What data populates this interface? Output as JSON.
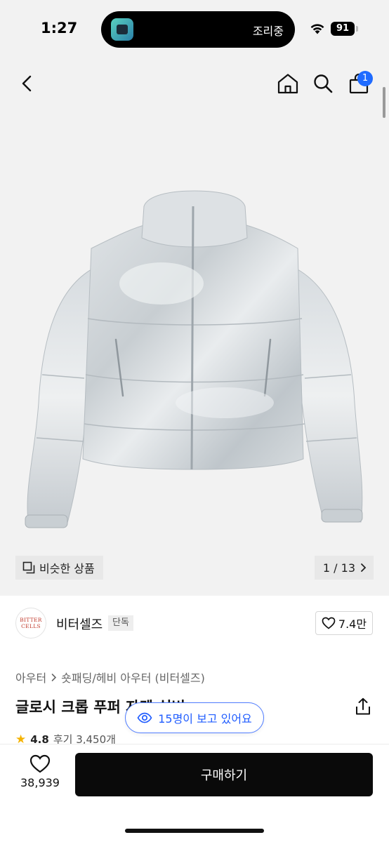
{
  "status_bar": {
    "time": "1:27",
    "live_activity": "조리중",
    "battery": "91"
  },
  "nav": {
    "cart_count": "1",
    "icons": [
      "back-arrow-icon",
      "home-icon",
      "search-icon",
      "cart-icon"
    ]
  },
  "gallery": {
    "similar_label": "비슷한 상품",
    "counter": "1 / 13"
  },
  "brand": {
    "logo_text_line1": "BITTER",
    "logo_text_line2": "CELLS",
    "name": "비터셀즈",
    "tag": "단독",
    "likes": "7.4만"
  },
  "breadcrumb": {
    "category": "아우터",
    "subcategory": "숏패딩/헤비 아우터 (비터셀즈)"
  },
  "product": {
    "title": "글로시 크롭 푸퍼 자켓 실버",
    "rating": "4.8",
    "reviews": "후기 3,450개"
  },
  "viewers": {
    "text": "15명이 보고 있어요"
  },
  "bottom": {
    "wish_count": "38,939",
    "buy_label": "구매하기"
  },
  "colors": {
    "accent": "#1f6bff",
    "buy_button": "#0a0a0a",
    "hero_bg": "#f2f2f2"
  }
}
